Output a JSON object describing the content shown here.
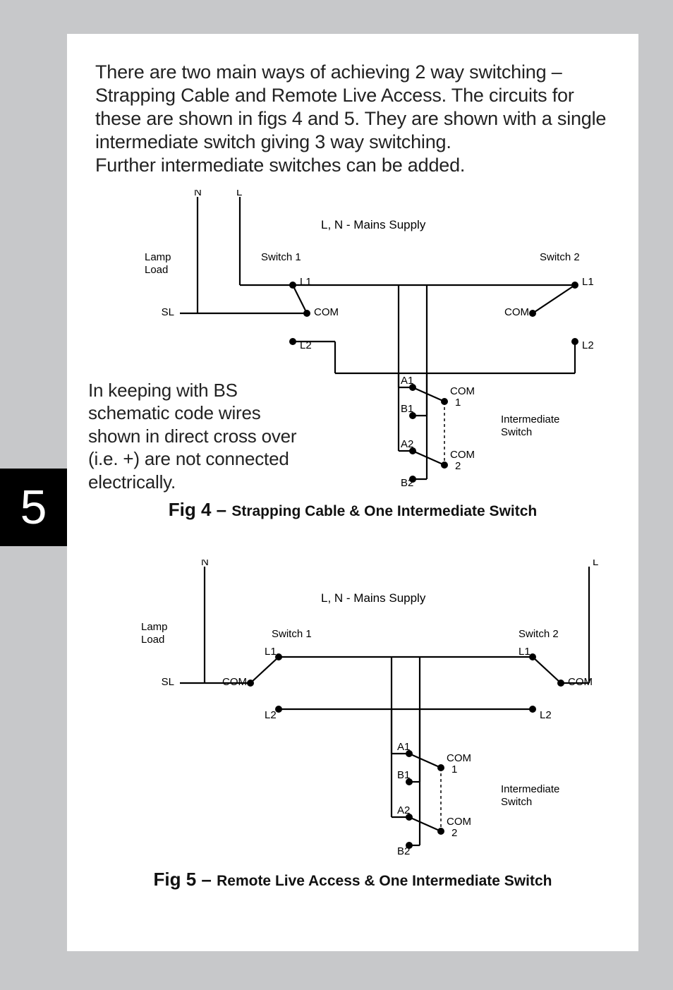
{
  "page_number": "5",
  "body": {
    "p1": "There are two main ways of achieving 2 way switching – Strapping Cable and Remote Live Access. The circuits for these are shown in figs 4 and 5. They are shown with a single intermediate switch giving 3 way switching.",
    "p2": "Further intermediate switches can be added."
  },
  "note": "In keeping with BS schematic code wires shown in direct cross over (i.e. +) are not connected electrically.",
  "fig4": {
    "caption_lead": "Fig 4 – ",
    "caption_rest": "Strapping Cable & One Intermediate Switch",
    "labels": {
      "N": "N",
      "L": "L",
      "mains": "L, N - Mains Supply",
      "lamp": "Lamp",
      "load": "Load",
      "sw1": "Switch 1",
      "sw2": "Switch 2",
      "SL": "SL",
      "L1": "L1",
      "L2": "L2",
      "COM": "COM",
      "A1": "A1",
      "B1": "B1",
      "A2": "A2",
      "B2": "B2",
      "COM1": "COM",
      "one": "1",
      "COM2": "COM",
      "two": "2",
      "inter": "Intermediate",
      "switch": "Switch"
    }
  },
  "fig5": {
    "caption_lead": "Fig 5 – ",
    "caption_rest": "Remote Live Access & One Intermediate Switch",
    "labels": {
      "N": "N",
      "L": "L",
      "mains": "L, N - Mains Supply",
      "lamp": "Lamp",
      "load": "Load",
      "sw1": "Switch 1",
      "sw2": "Switch 2",
      "SL": "SL",
      "L1": "L1",
      "L2": "L2",
      "COM": "COM",
      "A1": "A1",
      "B1": "B1",
      "A2": "A2",
      "B2": "B2",
      "COM1": "COM",
      "one": "1",
      "COM2": "COM",
      "two": "2",
      "inter": "Intermediate",
      "switch": "Switch"
    }
  }
}
